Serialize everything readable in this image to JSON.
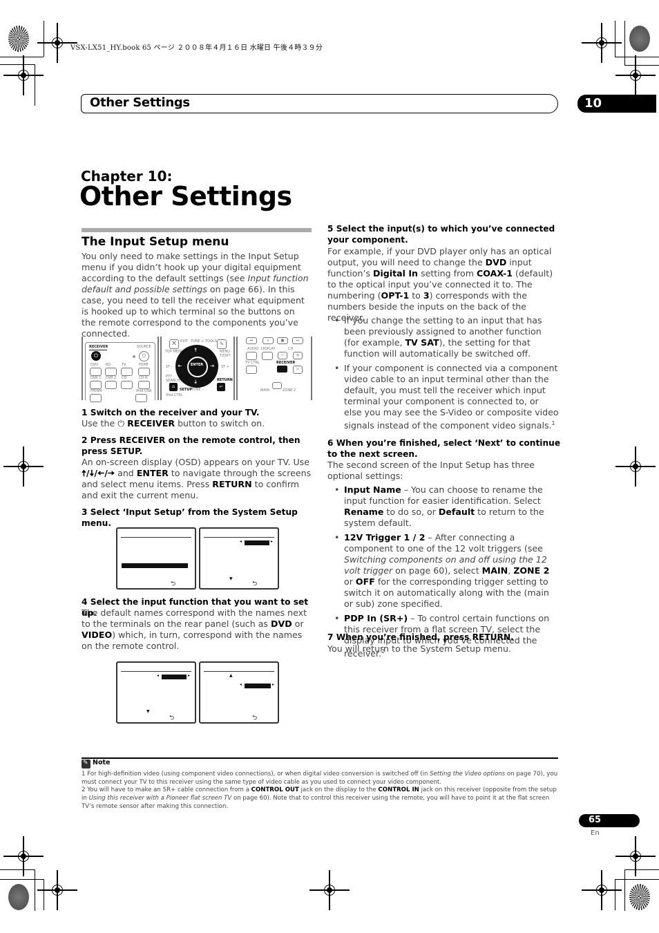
{
  "print_marks": {
    "book_info": "VSX-LX51_HY.book  65 ページ  ２００８年４月１６日  水曜日  午後４時３９分"
  },
  "header": {
    "section_title": "Other Settings",
    "chapter_number": "10"
  },
  "chapter": {
    "label": "Chapter 10:",
    "title": "Other Settings"
  },
  "section": {
    "title": "The Input Setup menu",
    "intro": [
      {
        "t": "You only need to make settings in the Input Setup menu if you didn’t hook up your digital equipment according to the default settings (see "
      },
      {
        "i": "Input function default and possible settings"
      },
      {
        "t": " on page 66). In this case, you need to tell the receiver what equipment is hooked up to which terminal so the buttons on the remote correspond to the components you’ve connected."
      }
    ]
  },
  "remote": {
    "panel1": {
      "receiver_label": "RECEIVER",
      "source_label": "SOURCE",
      "row1": [
        "DVD",
        "BD",
        "TV",
        "HDMI"
      ],
      "row2": [
        "DVR 1",
        "DVR 2",
        "CD",
        "CD-R"
      ],
      "row3_left": "FM/AM",
      "row3_right": "iPod USB"
    },
    "panel2": {
      "exit": "EXIT",
      "tools": "TOOLS",
      "top_menu": "TOP MENU",
      "menu": "MENU",
      "t_edit": "T.EDIT",
      "tune_plus": "TUNE +",
      "tune_minus": "TUNE –",
      "st_minus": "ST –",
      "st_plus": "ST +",
      "enter": "ENTER",
      "pty_search": "PTY SEARCH",
      "setup": "SETUP",
      "return": "RETURN",
      "ipod_ctrl": "iPod CTRL"
    },
    "panel3": {
      "audio": "AUDIO",
      "display": "DISPLAY",
      "ch": "CH",
      "tv_ctrl": "TV CTRL",
      "receiver": "RECEIVER",
      "main": "MAIN",
      "zone": "ZONE 2"
    }
  },
  "left_steps": [
    {
      "heading": "1   Switch on the receiver and your TV.",
      "body": [
        {
          "t": "Use the ⏻ "
        },
        {
          "b": "RECEIVER"
        },
        {
          "t": " button to switch on."
        }
      ]
    },
    {
      "heading": "2   Press RECEIVER on the remote control, then press SETUP.",
      "body": [
        {
          "t": "An on-screen display (OSD) appears on your TV. Use "
        },
        {
          "b": "🠅/🠇/🠄/🠆"
        },
        {
          "t": " and "
        },
        {
          "b": "ENTER"
        },
        {
          "t": " to navigate through the screens and select menu items. Press "
        },
        {
          "b": "RETURN"
        },
        {
          "t": " to confirm and exit the current menu."
        }
      ]
    },
    {
      "heading": "3   Select ‘Input Setup’ from the System Setup menu.",
      "body": []
    },
    {
      "heading": "4   Select the input function that you want to set up.",
      "body": [
        {
          "t": "The default names correspond with the names next to the terminals on the rear panel (such as "
        },
        {
          "b": "DVD"
        },
        {
          "t": " or "
        },
        {
          "b": "VIDEO"
        },
        {
          "t": ") which, in turn, correspond with the names on the remote control."
        }
      ]
    }
  ],
  "right_steps": {
    "step5": {
      "heading": "5   Select the input(s) to which you’ve connected your component.",
      "body": [
        {
          "t": "For example, if your DVD player only has an optical output, you will need to change the "
        },
        {
          "b": "DVD"
        },
        {
          "t": " input function’s "
        },
        {
          "b": "Digital In"
        },
        {
          "t": " setting from "
        },
        {
          "b": "COAX-1"
        },
        {
          "t": " (default) to the optical input you’ve connected it to. The numbering ("
        },
        {
          "b": "OPT-1"
        },
        {
          "t": " to "
        },
        {
          "b": "3"
        },
        {
          "t": ") corresponds with the numbers beside the inputs on the back of the receiver."
        }
      ],
      "bullets": [
        [
          {
            "t": "If you change the setting to an input that has been previously assigned to another function (for example, "
          },
          {
            "b": "TV SAT"
          },
          {
            "t": "), the setting for that function will automatically be switched off."
          }
        ],
        [
          {
            "t": "If your component is connected via a component video cable to an input terminal other than the default, you must tell the receiver which input terminal your component is connected to, or else you may see the S-Video or composite video signals instead of the component video signals."
          },
          {
            "sup": "1"
          }
        ]
      ]
    },
    "step6": {
      "heading": "6   When you’re finished, select ‘Next’ to continue to the next screen.",
      "body": [
        {
          "t": "The second screen of the Input Setup has three optional settings:"
        }
      ],
      "bullets": [
        [
          {
            "b": "Input Name"
          },
          {
            "t": " – You can choose to rename the input function for easier identification. Select "
          },
          {
            "b": "Rename"
          },
          {
            "t": " to do so, or "
          },
          {
            "b": "Default"
          },
          {
            "t": " to return to the system default."
          }
        ],
        [
          {
            "b": "12V Trigger 1 / 2"
          },
          {
            "t": " – After connecting a component to one of the 12 volt triggers (see "
          },
          {
            "i": "Switching components on and off using the 12 volt trigger"
          },
          {
            "t": " on page 60), select "
          },
          {
            "b": "MAIN"
          },
          {
            "t": ", "
          },
          {
            "b": "ZONE 2"
          },
          {
            "t": " or "
          },
          {
            "b": "OFF"
          },
          {
            "t": " for the corresponding trigger setting to switch it on automatically along with the (main or sub) zone specified."
          }
        ],
        [
          {
            "b": "PDP In (SR+)"
          },
          {
            "t": " – To control certain functions on this receiver from a flat screen TV, select the display input to which you’ve connected the receiver."
          },
          {
            "sup": "2"
          }
        ]
      ]
    },
    "step7": {
      "heading": "7   When you’re finished, press RETURN.",
      "body": [
        {
          "t": "You will return to the System Setup menu."
        }
      ]
    }
  },
  "osd": {
    "return_icon": "return-icon",
    "down_arrow": "▼",
    "up_arrow": "▲",
    "left_arrow": "◂",
    "right_arrow": "▸"
  },
  "note": {
    "label": "Note",
    "footnotes": [
      [
        {
          "t": "1  For high-definition video (using component video connections), or when digital video conversion is switched off (in "
        },
        {
          "i": "Setting the Video options"
        },
        {
          "t": " on page 70), you must connect your TV to this receiver using the same type of video cable as you used to connect your video component."
        }
      ],
      [
        {
          "t": "2  You will have to make an SR+ cable connection from a "
        },
        {
          "b": "CONTROL OUT"
        },
        {
          "t": " jack on the display to the "
        },
        {
          "b": "CONTROL IN"
        },
        {
          "t": " jack on this receiver (opposite from the setup in "
        },
        {
          "i": "Using this receiver with a Pioneer flat screen TV"
        },
        {
          "t": " on page 60). Note that to control this receiver using the remote, you will have to point it at the flat screen TV’s remote sensor after making this connection."
        }
      ]
    ]
  },
  "footer": {
    "page_number": "65",
    "language": "En"
  }
}
